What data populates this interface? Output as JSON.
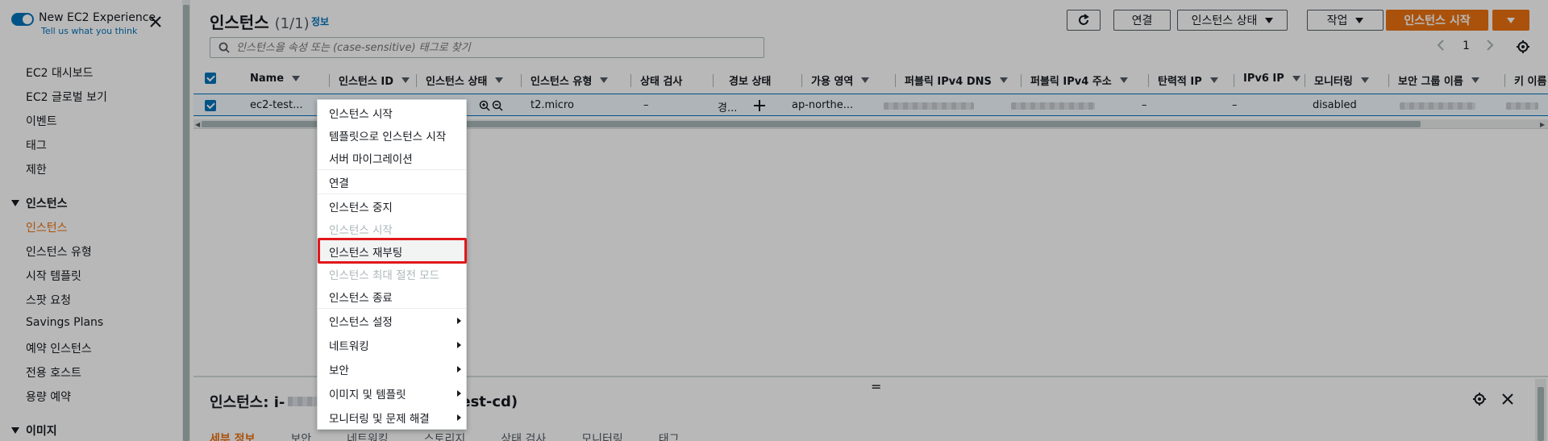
{
  "sidebar": {
    "experience_title": "New EC2 Experience",
    "experience_sub": "Tell us what you think",
    "items": [
      {
        "label": "EC2 대시보드"
      },
      {
        "label": "EC2 글로벌 보기"
      },
      {
        "label": "이벤트"
      },
      {
        "label": "태그"
      },
      {
        "label": "제한"
      }
    ],
    "section_instances": "인스턴스",
    "instance_items": [
      {
        "label": "인스턴스",
        "active": true
      },
      {
        "label": "인스턴스 유형"
      },
      {
        "label": "시작 템플릿"
      },
      {
        "label": "스팟 요청"
      },
      {
        "label": "Savings Plans"
      },
      {
        "label": "예약 인스턴스"
      },
      {
        "label": "전용 호스트"
      },
      {
        "label": "용량 예약"
      }
    ],
    "section_images": "이미지"
  },
  "header": {
    "title": "인스턴스",
    "count": "(1/1)",
    "info": "정보",
    "buttons": {
      "connect": "연결",
      "instance_state": "인스턴스 상태",
      "actions": "작업",
      "launch": "인스턴스 시작"
    }
  },
  "search": {
    "placeholder": "인스턴스을 속성 또는 (case-sensitive) 태그로 찾기"
  },
  "pager": {
    "page": "1"
  },
  "table": {
    "columns": [
      "Name",
      "인스턴스 ID",
      "인스턴스 상태",
      "인스턴스 유형",
      "상태 검사",
      "경보 상태",
      "가용 영역",
      "퍼블릭 IPv4 DNS",
      "퍼블릭 IPv4 주소",
      "탄력적 IP",
      "IPv6 IP",
      "모니터링",
      "보안 그룹 이름",
      "키 이름"
    ],
    "row": {
      "name": "ec2-test...",
      "instance_type": "t2.micro",
      "status_check": "–",
      "alarm_status": "경...",
      "availability_zone": "ap-northe...",
      "elastic_ip": "–",
      "ipv6": "–",
      "monitoring": "disabled"
    }
  },
  "context_menu": {
    "items": [
      {
        "label": "인스턴스 시작",
        "disabled": false
      },
      {
        "label": "템플릿으로 인스턴스 시작",
        "disabled": false
      },
      {
        "label": "서버 마이그레이션",
        "disabled": false
      },
      {
        "label": "연결",
        "disabled": false
      },
      {
        "label": "인스턴스 중지",
        "disabled": false
      },
      {
        "label": "인스턴스 시작",
        "disabled": true
      },
      {
        "label": "인스턴스 재부팅",
        "disabled": false,
        "highlighted": true
      },
      {
        "label": "인스턴스 최대 절전 모드",
        "disabled": true
      },
      {
        "label": "인스턴스 종료",
        "disabled": false
      },
      {
        "label": "인스턴스 설정",
        "submenu": true
      },
      {
        "label": "네트워킹",
        "submenu": true
      },
      {
        "label": "보안",
        "submenu": true
      },
      {
        "label": "이미지 및 템플릿",
        "submenu": true
      },
      {
        "label": "모니터링 및 문제 해결",
        "submenu": true
      }
    ]
  },
  "detail": {
    "title_prefix": "인스턴스: i-",
    "title_suffix": "est-cd)",
    "tabs": [
      "세부 정보",
      "보안",
      "네트워킹",
      "스토리지",
      "상태 검사",
      "모니터링",
      "태그"
    ]
  },
  "colors": {
    "primary": "#ec7211",
    "link": "#0073bb",
    "highlight_border": "#e0181b"
  }
}
